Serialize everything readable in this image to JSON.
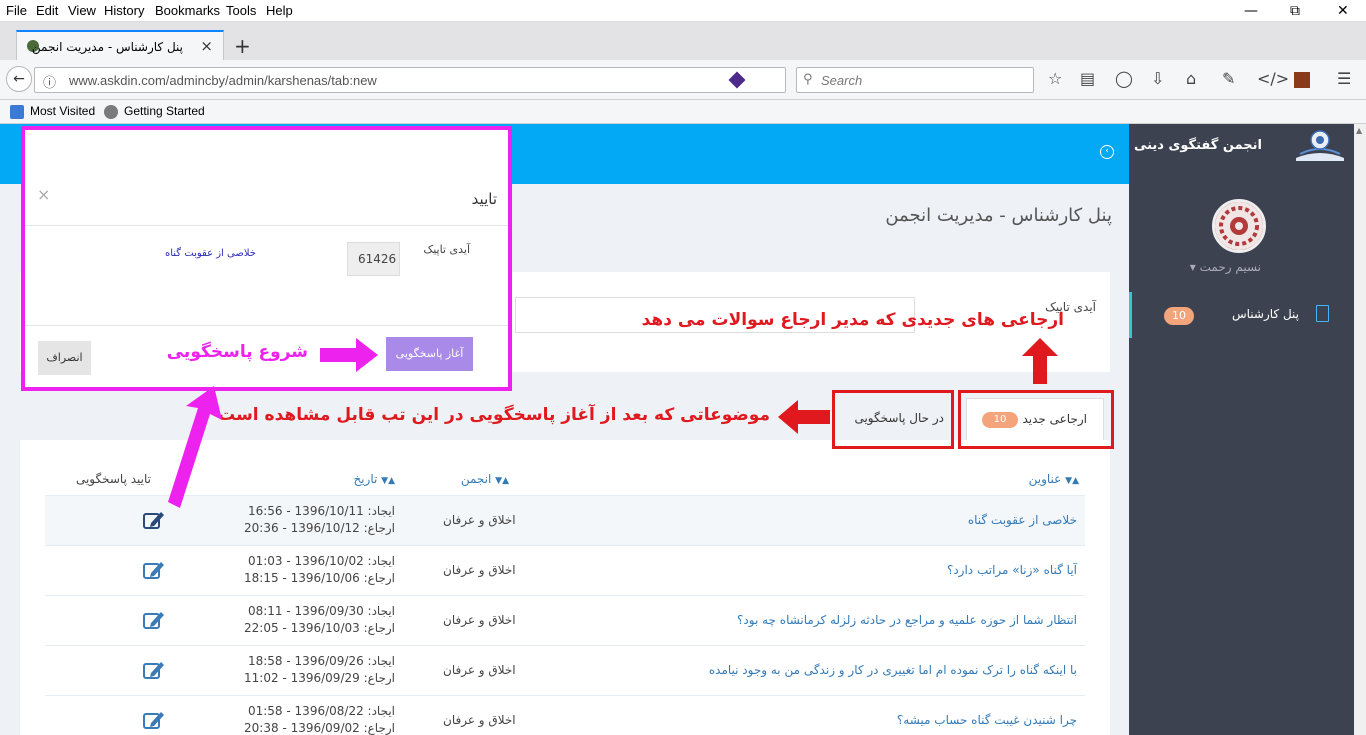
{
  "browser": {
    "menu": [
      "File",
      "Edit",
      "View",
      "History",
      "Bookmarks",
      "Tools",
      "Help"
    ],
    "tab_title": "پنل کارشناس - مدیریت انجمن",
    "url": "www.askdin.com/admincby/admin/karshenas/tab:new",
    "search_placeholder": "Search",
    "bookmarks": [
      "Most Visited",
      "Getting Started"
    ]
  },
  "app": {
    "brand": "انجمن گفتگوی دینی",
    "user_name": "نسیم رحمت",
    "sidebar_item": "پنل کارشناس",
    "sidebar_badge": "10",
    "page_title": "پنل کارشناس - مدیریت انجمن",
    "topic_id_label": "آیدی تاپیک"
  },
  "tabs": {
    "new_label": "ارجاعی جدید",
    "new_badge": "10",
    "progress_label": "در حال پاسخگویی"
  },
  "table": {
    "headers": {
      "title": "عناوین",
      "forum": "انجمن",
      "date": "تاریخ",
      "confirm": "تایید پاسخگویی"
    },
    "rows": [
      {
        "title": "خلاصی از عقوبت گناه",
        "forum": "اخلاق و عرفان",
        "created": "ایجاد: 1396/10/11 - 16:56",
        "referred": "ارجاع: 1396/10/12 - 20:36"
      },
      {
        "title": "آیا گناه «زنا» مراتب دارد؟",
        "forum": "اخلاق و عرفان",
        "created": "ایجاد: 1396/10/02 - 01:03",
        "referred": "ارجاع: 1396/10/06 - 18:15"
      },
      {
        "title": "انتظار شما از حوزه علمیه و مراجع در حادثه زلزله کرمانشاه چه بود؟",
        "forum": "اخلاق و عرفان",
        "created": "ایجاد: 1396/09/30 - 08:11",
        "referred": "ارجاع: 1396/10/03 - 22:05"
      },
      {
        "title": "با اینکه گناه را ترک نموده ام اما تغییری در کار و زندگی من به وجود نیامده",
        "forum": "اخلاق و عرفان",
        "created": "ایجاد: 1396/09/26 - 18:58",
        "referred": "ارجاع: 1396/09/29 - 11:02"
      },
      {
        "title": "چرا شنیدن غیبت گناه حساب میشه؟",
        "forum": "اخلاق و عرفان",
        "created": "ایجاد: 1396/08/22 - 01:58",
        "referred": "ارجاع: 1396/09/02 - 20:38"
      }
    ]
  },
  "modal": {
    "title": "تایید",
    "close": "×",
    "topic_id_label": "آیدی تاپیک",
    "topic_id_value": "61426",
    "topic_title": "خلاصی از عقوبت گناه",
    "start_button": "آغاز پاسخگویی",
    "cancel_button": "انصراف"
  },
  "annotations": {
    "new_referrals": "ارجاعی های جدیدی که مدیر ارجاع سوالات می دهد",
    "in_progress": "موضوعاتی که بعد از آغاز پاسخگویی در این تب قابل مشاهده است",
    "start_answering": "شروع پاسخگویی"
  },
  "colors": {
    "accent": "#03a9f4",
    "sidebar": "#3d4250",
    "annotation_red": "#e0191f",
    "annotation_magenta": "#ee22ee"
  }
}
